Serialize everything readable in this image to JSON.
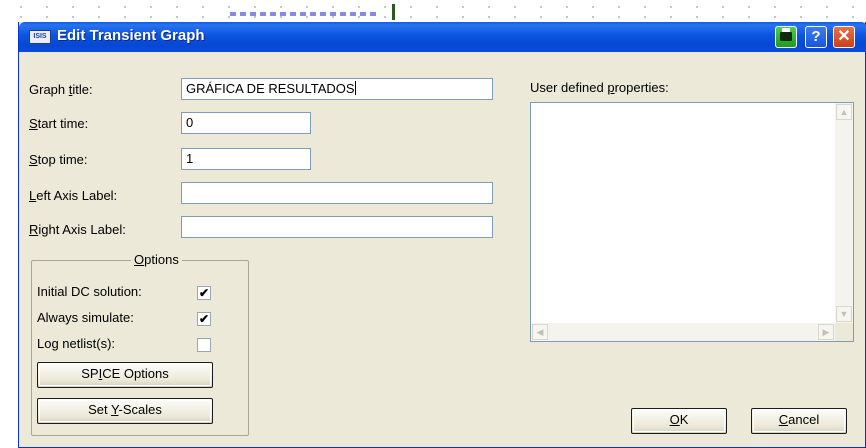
{
  "window": {
    "app_icon_text": "ISIS",
    "title": "Edit Transient Graph",
    "help_label": "?",
    "close_label": "✕"
  },
  "form": {
    "graph_title": {
      "label_pre": "Graph ",
      "label_key": "t",
      "label_post": "itle:",
      "value": "GRÁFICA DE RESULTADOS"
    },
    "start_time": {
      "label_key": "S",
      "label_post": "tart time:",
      "value": "0"
    },
    "stop_time": {
      "label_key": "S",
      "label_post": "top time:",
      "value": "1"
    },
    "left_axis": {
      "label_key": "L",
      "label_post": "eft Axis Label:",
      "value": ""
    },
    "right_axis": {
      "label_key": "R",
      "label_post": "ight Axis Label:",
      "value": ""
    }
  },
  "options": {
    "title_key": "O",
    "title_post": "ptions",
    "initial_dc": {
      "label": "Initial DC solution:",
      "checked": true,
      "mark": "✔"
    },
    "always_simulate": {
      "label": "Always simulate:",
      "checked": true,
      "mark": "✔"
    },
    "log_netlist": {
      "label": "Log netlist(s):",
      "checked": false,
      "mark": ""
    },
    "spice_button": {
      "pre": "SP",
      "key": "I",
      "post": "CE Options"
    },
    "yscales_button": {
      "pre": "Set ",
      "key": "Y",
      "post": "-Scales"
    }
  },
  "user_props": {
    "label_pre": "User defined ",
    "label_key": "p",
    "label_post": "roperties:",
    "up_arrow": "▲",
    "down_arrow": "▼",
    "left_arrow": "◀",
    "right_arrow": "▶"
  },
  "footer": {
    "ok": {
      "key": "O",
      "post": "K"
    },
    "cancel": {
      "key": "C",
      "post": "ancel"
    }
  }
}
